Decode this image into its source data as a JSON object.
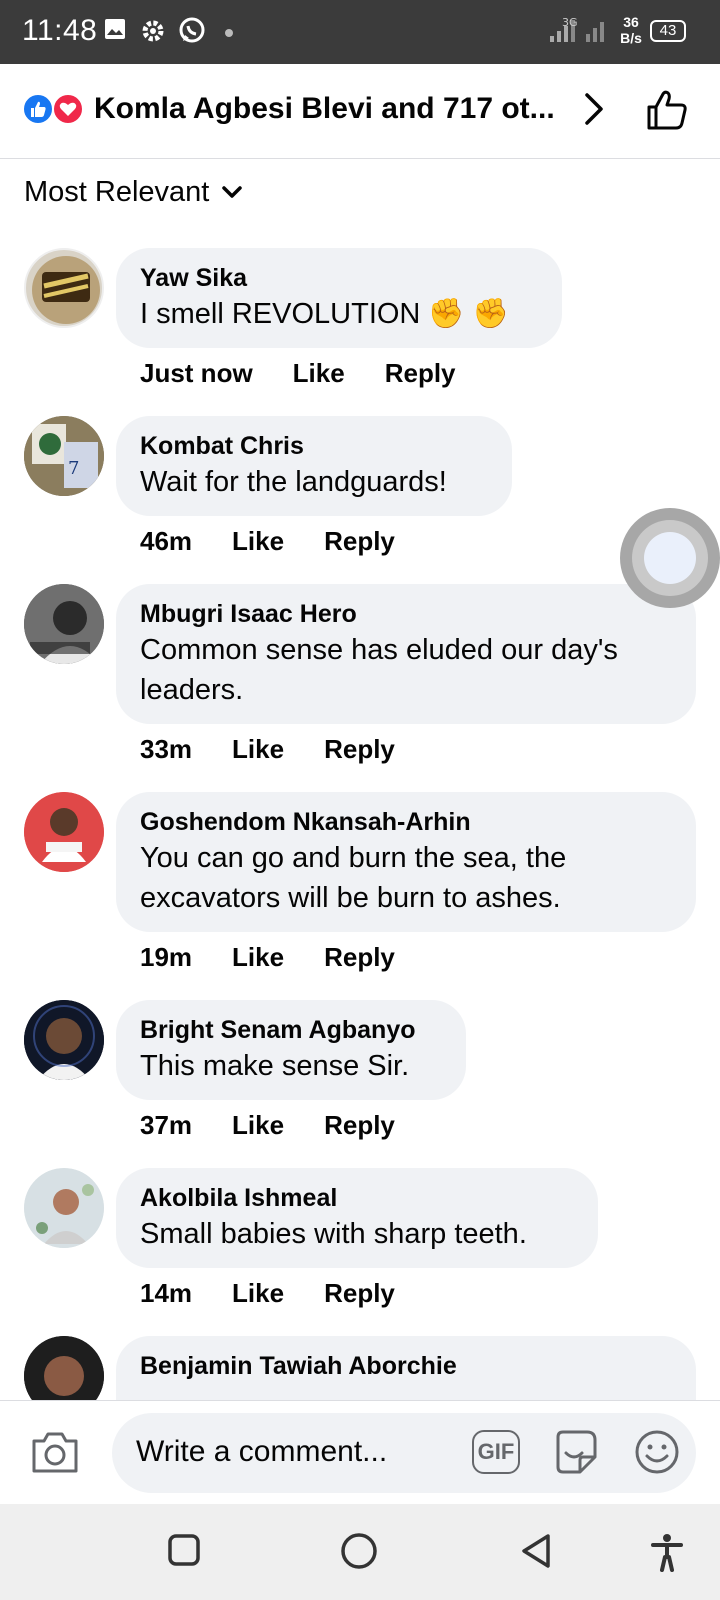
{
  "status_bar": {
    "time": "11:48",
    "network_speed": "36",
    "network_unit": "B/s",
    "battery": "43",
    "icons": [
      "gallery-icon",
      "settings-icon",
      "whatsapp-icon",
      "dot-icon",
      "signal-icon",
      "signal-icon",
      "battery-icon"
    ]
  },
  "header": {
    "title": "Komla Agbesi Blevi and 717 ot...",
    "reactions": [
      "like",
      "love"
    ],
    "colors": {
      "like": "#1877f2",
      "love": "#f0284a"
    }
  },
  "sort": {
    "label": "Most Relevant"
  },
  "actions": {
    "like": "Like",
    "reply": "Reply"
  },
  "comments": [
    {
      "name": "Yaw Sika",
      "text": "I smell REVOLUTION ✊ ✊",
      "time": "Just now"
    },
    {
      "name": "Kombat Chris",
      "text": "Wait for the landguards!",
      "time": "46m"
    },
    {
      "name": "Mbugri Isaac Hero",
      "text": "Common sense has eluded our day's leaders.",
      "time": "33m"
    },
    {
      "name": "Goshendom Nkansah-Arhin",
      "text": "You can go and burn the sea, the excavators will be burn to ashes.",
      "time": "19m"
    },
    {
      "name": "Bright Senam Agbanyo",
      "text": "This make sense Sir.",
      "time": "37m"
    },
    {
      "name": "Akolbila Ishmeal",
      "text": "Small babies with sharp teeth.",
      "time": "14m"
    },
    {
      "name": "Benjamin Tawiah Aborchie"
    }
  ],
  "composer": {
    "placeholder": "Write a comment...",
    "gif_label": "GIF"
  }
}
